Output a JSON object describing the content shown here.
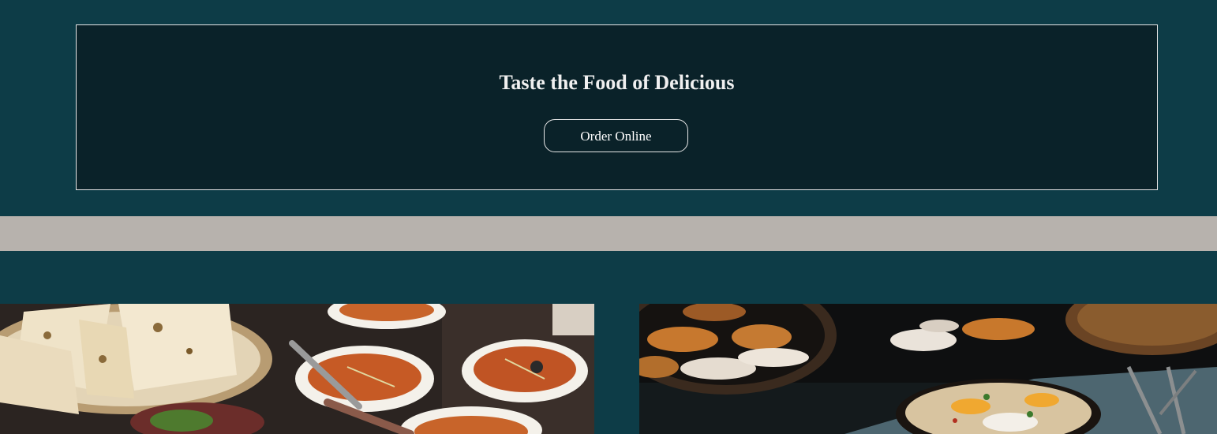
{
  "promo": {
    "title": "Taste the Food of Delicious",
    "order_button_label": "Order Online"
  },
  "gallery": {
    "images": [
      {
        "icon": "indian-curry-naan-photo"
      },
      {
        "icon": "eggs-shakshuka-photo"
      }
    ]
  },
  "colors": {
    "page_background": "#0d3c47",
    "promo_box_background": "#0a2229",
    "divider_band": "#b7b2ad",
    "border": "#e6e6e6"
  }
}
